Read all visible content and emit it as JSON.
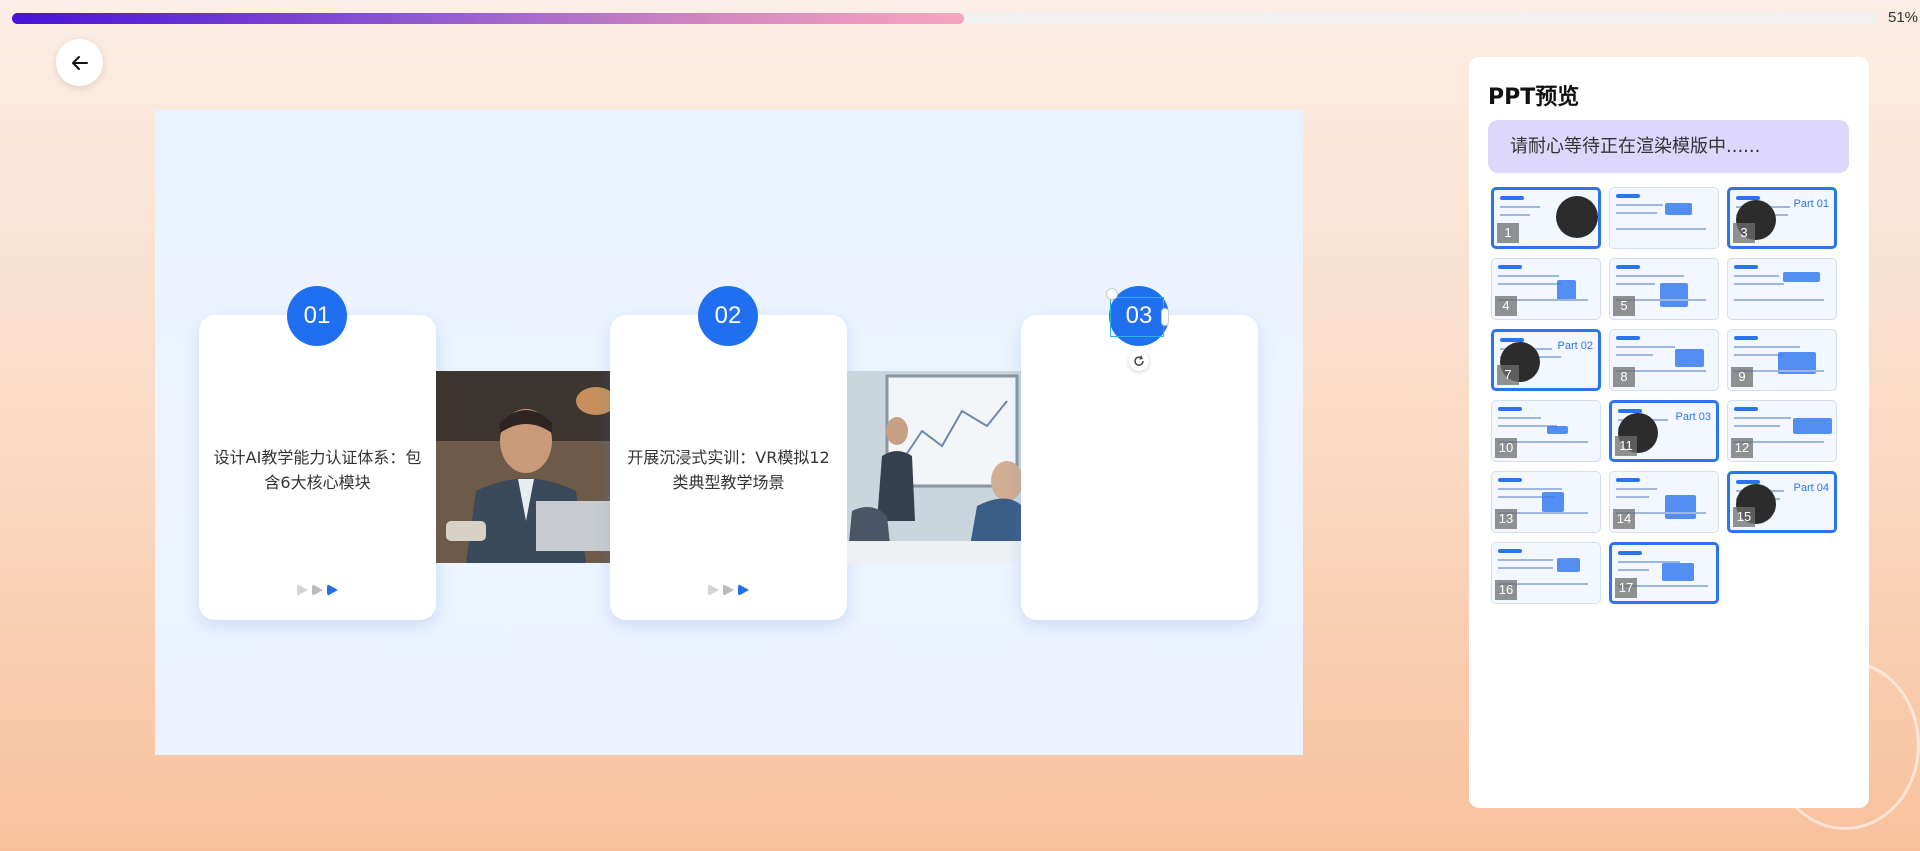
{
  "progress": {
    "percent_label": "51%",
    "fraction": 0.51
  },
  "back": {
    "icon": "arrow-left-icon"
  },
  "slide": {
    "cards": [
      {
        "number": "01",
        "text": "设计AI教学能力认证体系：包含6大核心模块"
      },
      {
        "number": "02",
        "text": "开展沉浸式实训：VR模拟12类典型教学场景"
      },
      {
        "number": "03",
        "text": ""
      }
    ]
  },
  "panel": {
    "title": "PPT预览",
    "notice": "请耐心等待正在渲染模版中......",
    "thumbs": [
      {
        "n": "1",
        "part": ""
      },
      {
        "n": "",
        "part": ""
      },
      {
        "n": "3",
        "part": "Part 01"
      },
      {
        "n": "4",
        "part": ""
      },
      {
        "n": "5",
        "part": ""
      },
      {
        "n": "",
        "part": ""
      },
      {
        "n": "7",
        "part": "Part 02"
      },
      {
        "n": "8",
        "part": ""
      },
      {
        "n": "9",
        "part": ""
      },
      {
        "n": "10",
        "part": ""
      },
      {
        "n": "11",
        "part": "Part 03"
      },
      {
        "n": "12",
        "part": ""
      },
      {
        "n": "13",
        "part": ""
      },
      {
        "n": "14",
        "part": ""
      },
      {
        "n": "15",
        "part": "Part 04"
      },
      {
        "n": "16",
        "part": ""
      },
      {
        "n": "17",
        "part": ""
      }
    ]
  },
  "colors": {
    "accent": "#1f6ff0",
    "progress_start": "#4a10d8",
    "progress_end": "#f7a5c0"
  }
}
